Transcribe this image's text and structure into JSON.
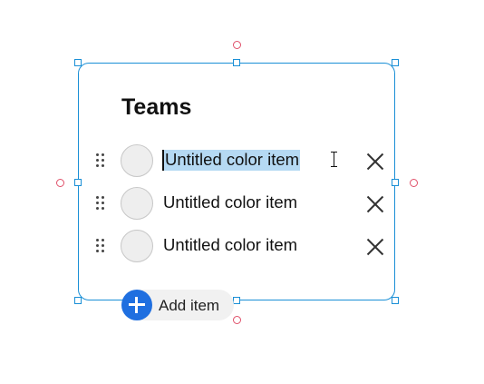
{
  "widget": {
    "title": "Teams",
    "items": [
      {
        "label": "Untitled color item",
        "selected": true
      },
      {
        "label": "Untitled color item",
        "selected": false
      },
      {
        "label": "Untitled color item",
        "selected": false
      }
    ],
    "add_label": "Add item"
  },
  "colors": {
    "selection_border": "#1a8fd6",
    "rotation_handle": "#e0506a",
    "text_selection": "#b5d9f3",
    "add_button": "#1f6fe0",
    "swatch_fill": "#eeeeee"
  },
  "icons": {
    "drag": "drag-handle-icon",
    "remove": "close-icon",
    "add": "plus-icon",
    "cursor": "text-cursor-icon"
  }
}
